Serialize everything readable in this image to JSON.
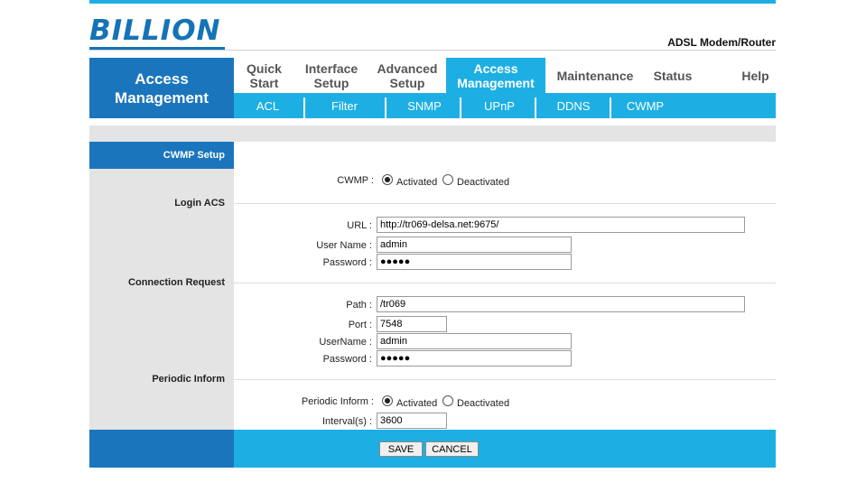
{
  "brand": {
    "logo_text": "BILLION",
    "product": "ADSL Modem/Router"
  },
  "section_title": "Access Management",
  "nav": [
    {
      "label": "Quick Start"
    },
    {
      "label": "Interface Setup"
    },
    {
      "label": "Advanced Setup"
    },
    {
      "label": "Access Management"
    },
    {
      "label": "Maintenance"
    },
    {
      "label": "Status"
    },
    {
      "label": "Help"
    }
  ],
  "subnav": [
    {
      "label": "ACL"
    },
    {
      "label": "Filter"
    },
    {
      "label": "SNMP"
    },
    {
      "label": "UPnP"
    },
    {
      "label": "DDNS"
    },
    {
      "label": "CWMP"
    }
  ],
  "page": {
    "setup_heading": "CWMP Setup",
    "cwmp": {
      "label": "CWMP :",
      "options": [
        "Activated",
        "Deactivated"
      ],
      "selected": "Activated"
    },
    "login_acs": {
      "heading": "Login ACS",
      "url_label": "URL :",
      "url_value": "http://tr069-delsa.net:9675/",
      "username_label": "User Name :",
      "username_value": "admin",
      "password_label": "Password :",
      "password_value": "●●●●●"
    },
    "connection_request": {
      "heading": "Connection Request",
      "path_label": "Path :",
      "path_value": "/tr069",
      "port_label": "Port :",
      "port_value": "7548",
      "username_label": "UserName :",
      "username_value": "admin",
      "password_label": "Password :",
      "password_value": "●●●●●"
    },
    "periodic_inform": {
      "heading": "Periodic Inform",
      "label": "Periodic Inform :",
      "options": [
        "Activated",
        "Deactivated"
      ],
      "selected": "Activated",
      "interval_label": "Interval(s) :",
      "interval_value": "3600"
    }
  },
  "buttons": {
    "save": "SAVE",
    "cancel": "CANCEL"
  },
  "colors": {
    "dark_blue": "#1b75bc",
    "light_blue": "#1dafe4",
    "grey": "#e4e4e4"
  }
}
